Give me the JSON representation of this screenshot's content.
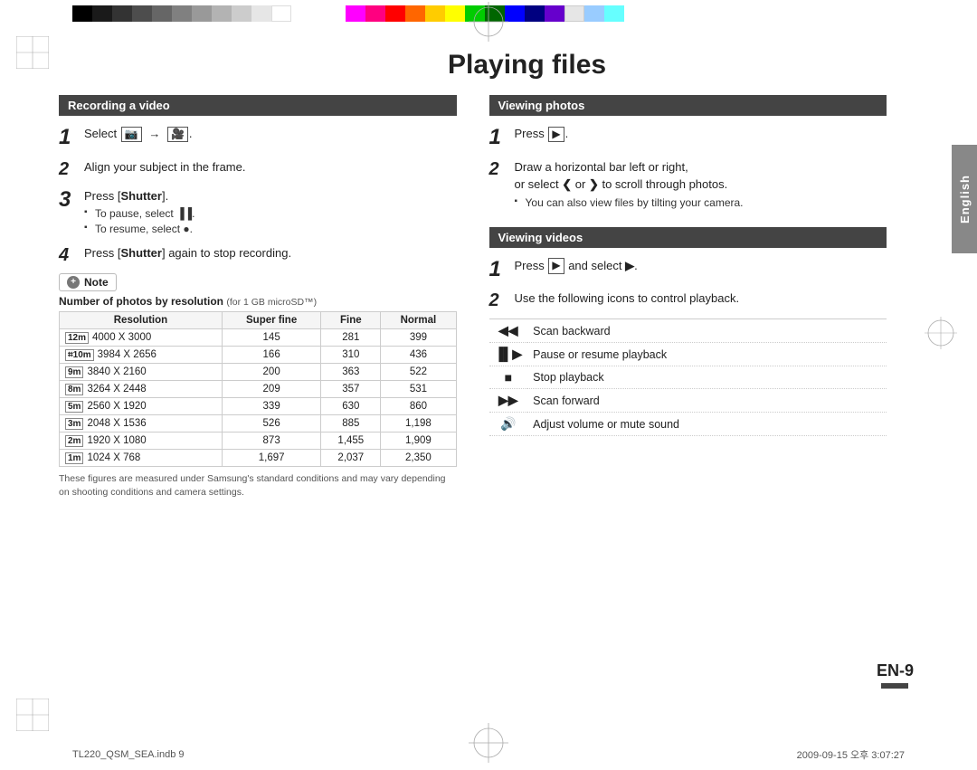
{
  "page": {
    "title": "Playing files",
    "page_number": "EN-9",
    "file_info": "TL220_QSM_SEA.indb   9",
    "date_info": "2009-09-15   오후 3:07:27"
  },
  "side_tab": {
    "label": "English"
  },
  "left_section": {
    "header": "Recording a video",
    "steps": [
      {
        "num": "1",
        "text": "Select"
      },
      {
        "num": "2",
        "text": "Align your subject in the frame."
      },
      {
        "num": "3",
        "text": "Press [Shutter].",
        "bullets": [
          "To pause, select ▐▐.",
          "To resume, select ●."
        ]
      },
      {
        "num": "4",
        "text": "Press [Shutter] again to stop recording."
      }
    ],
    "note_label": "Note",
    "table_title": "Number of photos by resolution",
    "table_subtitle": "(for 1 GB microSD™)",
    "table_headers": [
      "Resolution",
      "Super fine",
      "Fine",
      "Normal"
    ],
    "table_rows": [
      {
        "icon": "12m",
        "res": "4000 X 3000",
        "sf": "145",
        "f": "281",
        "n": "399"
      },
      {
        "icon": "⌗10m",
        "res": "3984 X 2656",
        "sf": "166",
        "f": "310",
        "n": "436"
      },
      {
        "icon": "9m",
        "res": "3840 X 2160",
        "sf": "200",
        "f": "363",
        "n": "522"
      },
      {
        "icon": "8m",
        "res": "3264 X 2448",
        "sf": "209",
        "f": "357",
        "n": "531"
      },
      {
        "icon": "5m",
        "res": "2560 X 1920",
        "sf": "339",
        "f": "630",
        "n": "860"
      },
      {
        "icon": "3m",
        "res": "2048 X 1536",
        "sf": "526",
        "f": "885",
        "n": "1,198"
      },
      {
        "icon": "2m",
        "res": "1920 X 1080",
        "sf": "873",
        "f": "1,455",
        "n": "1,909"
      },
      {
        "icon": "1m",
        "res": "1024 X 768",
        "sf": "1,697",
        "f": "2,037",
        "n": "2,350"
      }
    ],
    "table_note": "These figures are measured under Samsung's standard conditions and may vary depending on shooting conditions and camera settings."
  },
  "right_section": {
    "viewing_photos": {
      "header": "Viewing photos",
      "steps": [
        {
          "num": "1",
          "text": "Press [▶]."
        },
        {
          "num": "2",
          "text": "Draw a horizontal bar left or right, or select ❮ or ❯ to scroll through photos.",
          "bullets": [
            "You can also view files by tilting your camera."
          ]
        }
      ]
    },
    "viewing_videos": {
      "header": "Viewing videos",
      "steps": [
        {
          "num": "1",
          "text": "Press [▶] and select ▶."
        },
        {
          "num": "2",
          "text": "Use the following icons to control playback."
        }
      ],
      "controls": [
        {
          "icon": "⏮",
          "label": "Scan backward"
        },
        {
          "icon": "⏯",
          "label": "Pause or resume playback"
        },
        {
          "icon": "■",
          "label": "Stop playback"
        },
        {
          "icon": "⏭",
          "label": "Scan forward"
        },
        {
          "icon": "🔊",
          "label": "Adjust volume or mute sound"
        }
      ]
    }
  }
}
